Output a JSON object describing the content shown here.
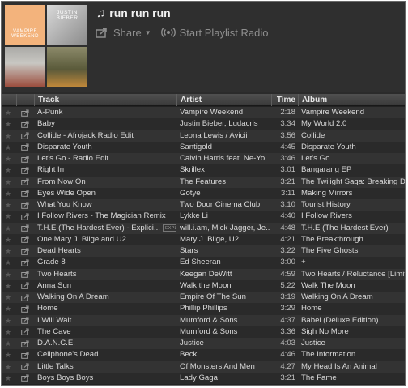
{
  "playlist": {
    "title": "run run run",
    "covers": [
      {
        "text": "VAMPIRE WEEKEND"
      },
      {
        "text": "JUSTIN BIEBER"
      },
      {
        "text": ""
      },
      {
        "text": ""
      }
    ]
  },
  "actions": {
    "share_label": "Share",
    "radio_label": "Start Playlist Radio"
  },
  "columns": {
    "track": "Track",
    "artist": "Artist",
    "time": "Time",
    "album": "Album"
  },
  "explicit_label": "EXPLICIT",
  "tracks": [
    {
      "track": "A-Punk",
      "artist": "Vampire Weekend",
      "time": "2:18",
      "album": "Vampire Weekend"
    },
    {
      "track": "Baby",
      "artist": "Justin Bieber, Ludacris",
      "time": "3:34",
      "album": "My World 2.0"
    },
    {
      "track": "Collide - Afrojack Radio Edit",
      "artist": "Leona Lewis / Avicii",
      "time": "3:56",
      "album": "Collide"
    },
    {
      "track": "Disparate Youth",
      "artist": "Santigold",
      "time": "4:45",
      "album": "Disparate Youth"
    },
    {
      "track": "Let's Go - Radio Edit",
      "artist": "Calvin Harris feat. Ne-Yo",
      "time": "3:46",
      "album": "Let's Go"
    },
    {
      "track": "Right In",
      "artist": "Skrillex",
      "time": "3:01",
      "album": "Bangarang EP"
    },
    {
      "track": "From Now On",
      "artist": "The Features",
      "time": "3:21",
      "album": "The Twilight Saga: Breaking Dawn"
    },
    {
      "track": "Eyes Wide Open",
      "artist": "Gotye",
      "time": "3:11",
      "album": "Making Mirrors"
    },
    {
      "track": "What You Know",
      "artist": "Two Door Cinema Club",
      "time": "3:10",
      "album": "Tourist History"
    },
    {
      "track": "I Follow Rivers - The Magician Remix",
      "artist": "Lykke Li",
      "time": "4:40",
      "album": "I Follow Rivers"
    },
    {
      "track": "T.H.E (The Hardest Ever) - Explici...",
      "artist": "will.i.am, Mick Jagger, Je...",
      "time": "4:48",
      "album": "T.H.E (The Hardest Ever)",
      "explicit": true
    },
    {
      "track": "One Mary J. Blige and U2",
      "artist": "Mary J. Blige, U2",
      "time": "4:21",
      "album": "The Breakthrough"
    },
    {
      "track": "Dead Hearts",
      "artist": "Stars",
      "time": "3:22",
      "album": "The Five Ghosts"
    },
    {
      "track": "Grade 8",
      "artist": "Ed Sheeran",
      "time": "3:00",
      "album": "+"
    },
    {
      "track": "Two Hearts",
      "artist": "Keegan DeWitt",
      "time": "4:59",
      "album": "Two Hearts / Reluctance [Limited E"
    },
    {
      "track": "Anna Sun",
      "artist": "Walk the Moon",
      "time": "5:22",
      "album": "Walk The Moon"
    },
    {
      "track": "Walking On A Dream",
      "artist": "Empire Of The Sun",
      "time": "3:19",
      "album": "Walking On A Dream"
    },
    {
      "track": "Home",
      "artist": "Phillip Phillips",
      "time": "3:29",
      "album": "Home"
    },
    {
      "track": "I Will Wait",
      "artist": "Mumford & Sons",
      "time": "4:37",
      "album": "Babel (Deluxe Edition)"
    },
    {
      "track": "The Cave",
      "artist": "Mumford & Sons",
      "time": "3:36",
      "album": "Sigh No More"
    },
    {
      "track": "D.A.N.C.E.",
      "artist": "Justice",
      "time": "4:03",
      "album": "Justice"
    },
    {
      "track": "Cellphone's Dead",
      "artist": "Beck",
      "time": "4:46",
      "album": "The Information"
    },
    {
      "track": "Little Talks",
      "artist": "Of Monsters And Men",
      "time": "4:27",
      "album": "My Head Is An Animal"
    },
    {
      "track": "Boys Boys Boys",
      "artist": "Lady Gaga",
      "time": "3:21",
      "album": "The Fame"
    }
  ]
}
